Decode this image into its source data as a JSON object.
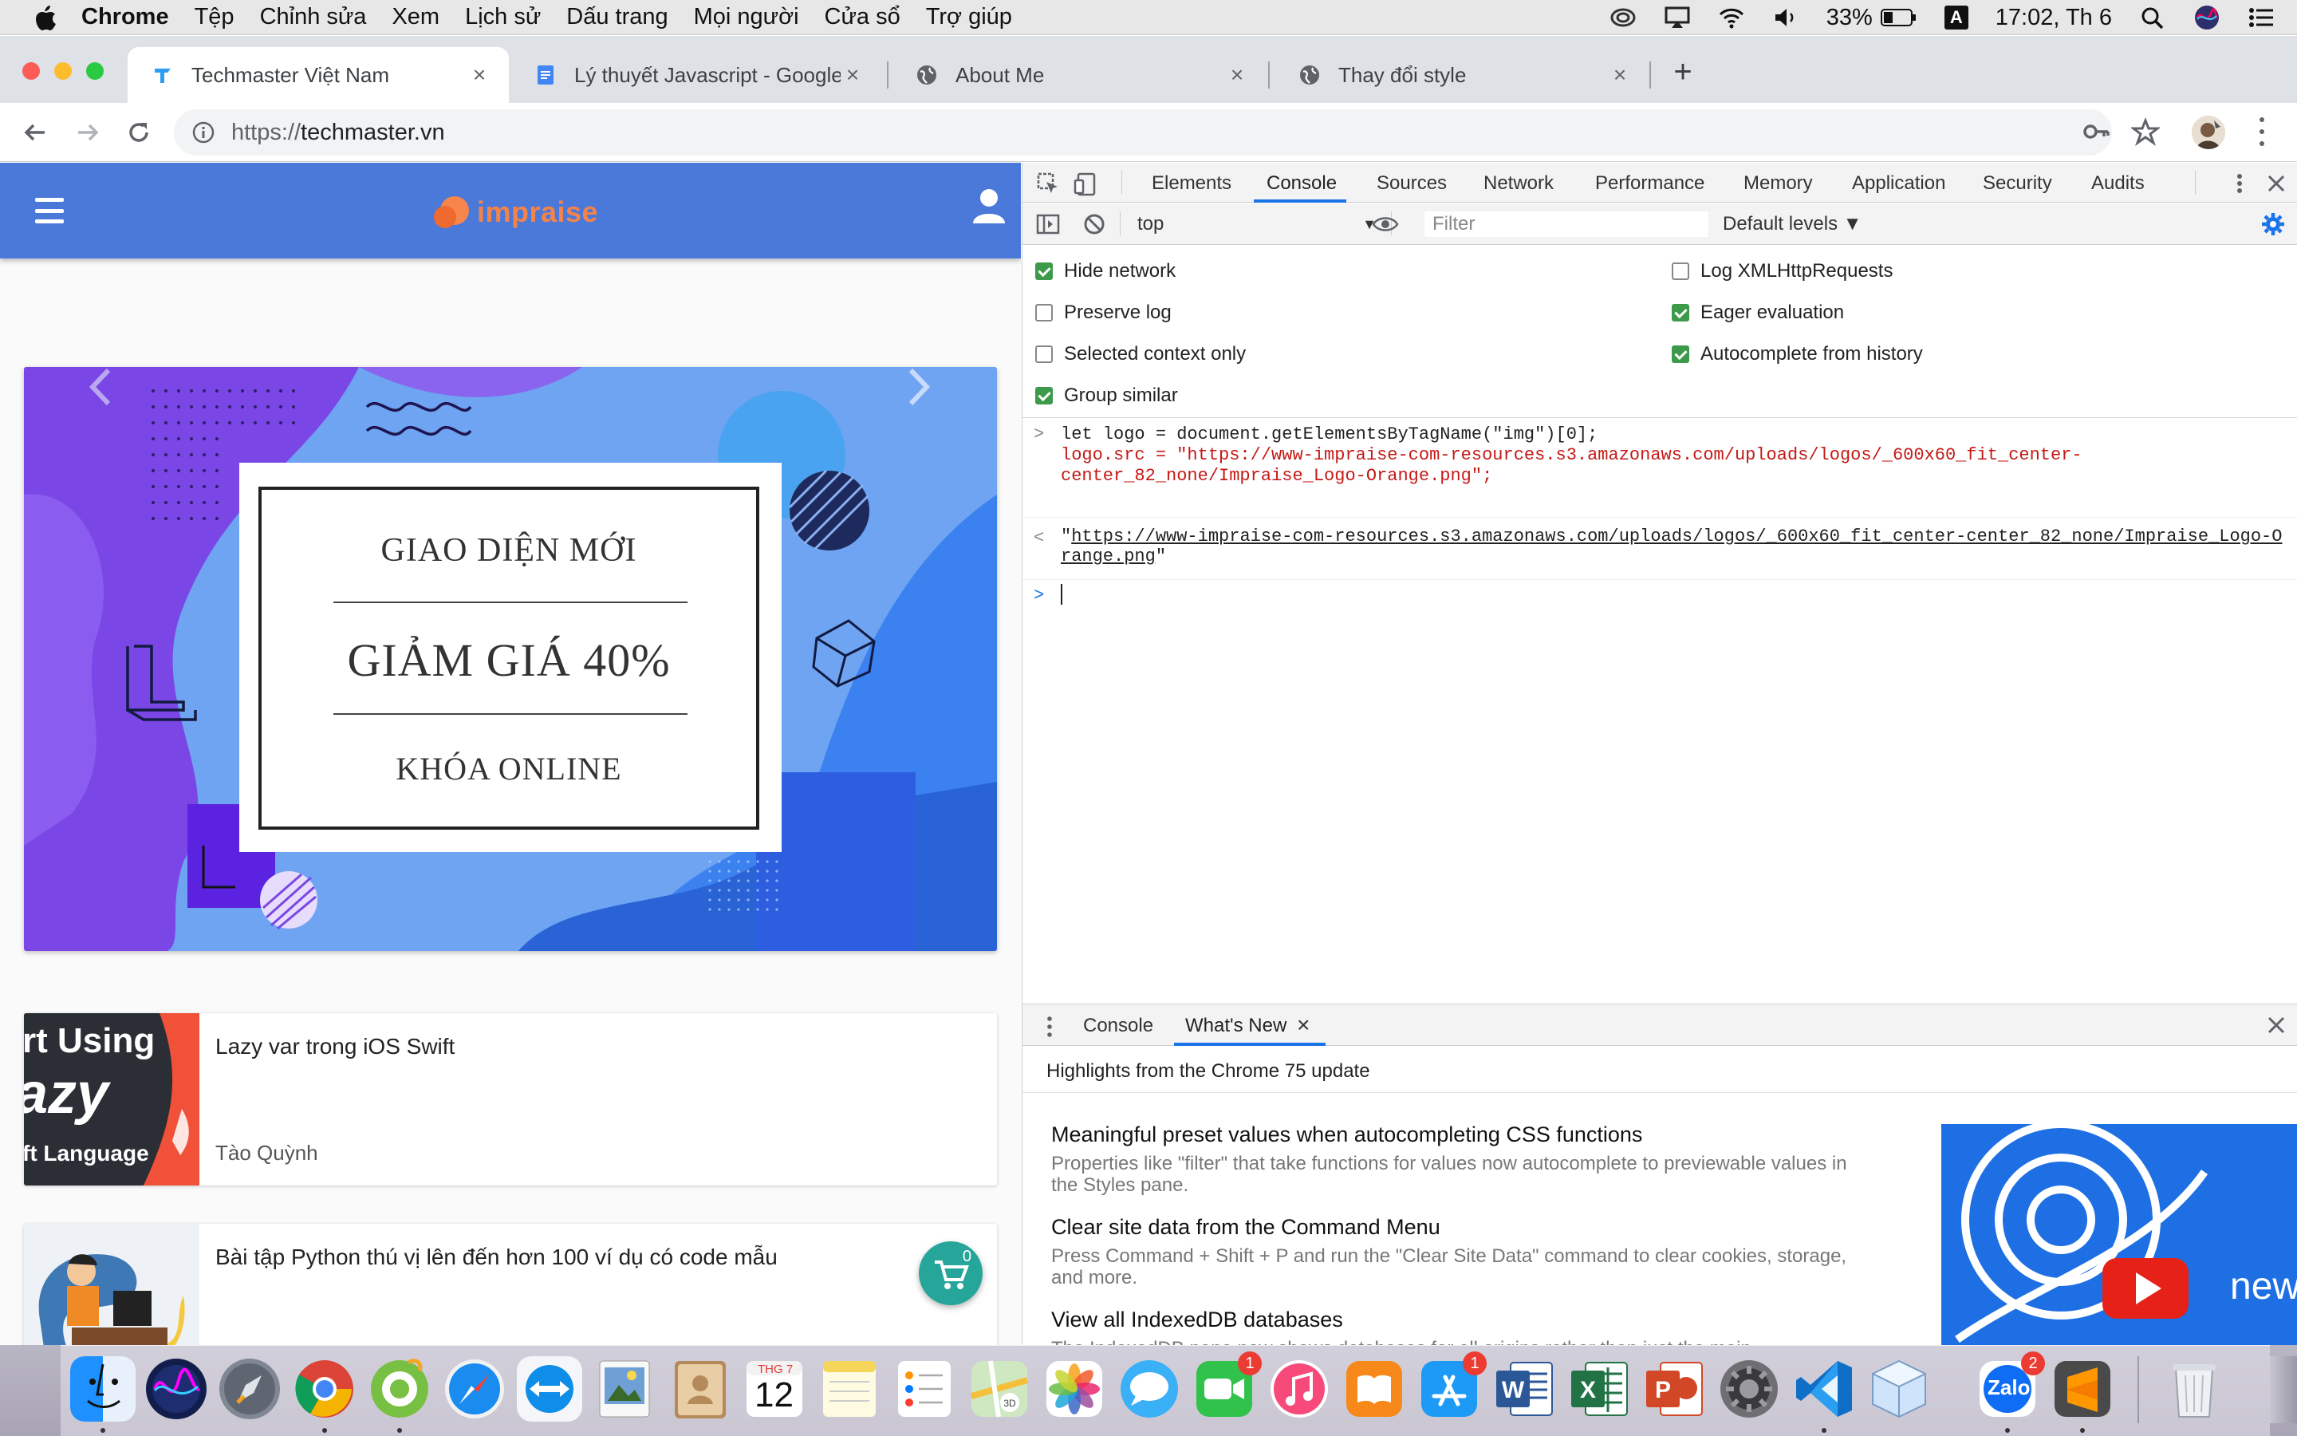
{
  "menubar": {
    "app": "Chrome",
    "items": [
      "Tệp",
      "Chỉnh sửa",
      "Xem",
      "Lịch sử",
      "Dấu trang",
      "Mọi người",
      "Cửa sổ",
      "Trợ giúp"
    ],
    "battery": "33%",
    "input_source": "A",
    "clock": "17:02, Th 6"
  },
  "tabs": [
    {
      "title": "Techmaster Việt Nam",
      "close": "×"
    },
    {
      "title": "Lý thuyết Javascript - Google T",
      "close": "×"
    },
    {
      "title": "About Me",
      "close": "×"
    },
    {
      "title": "Thay đổi style",
      "close": "×"
    }
  ],
  "newtab_label": "+",
  "omnibox": {
    "scheme": "https://",
    "host": "techmaster.vn"
  },
  "site": {
    "brand": "impraise",
    "banner": {
      "line1": "GIAO DIỆN MỚI",
      "line2": "GIẢM GIÁ 40%",
      "line3": "KHÓA ONLINE"
    },
    "posts": [
      {
        "title": "Lazy var trong iOS Swift",
        "author": "Tào Quỳnh",
        "thumb_lines": [
          "rt Using",
          "azy",
          "ft Language"
        ]
      },
      {
        "title": "Bài tập Python thú vị lên đến hơn 100 ví dụ có code mẫu",
        "author": ""
      }
    ],
    "cart_count": "0"
  },
  "devtools": {
    "tabs": [
      "Elements",
      "Console",
      "Sources",
      "Network",
      "Performance",
      "Memory",
      "Application",
      "Security",
      "Audits"
    ],
    "active_tab": "Console",
    "context": "top",
    "filter_placeholder": "Filter",
    "levels": "Default levels ▼",
    "settings": [
      {
        "label": "Hide network",
        "checked": true
      },
      {
        "label": "Preserve log",
        "checked": false
      },
      {
        "label": "Selected context only",
        "checked": false
      },
      {
        "label": "Group similar",
        "checked": true
      },
      {
        "label": "Log XMLHttpRequests",
        "checked": false
      },
      {
        "label": "Eager evaluation",
        "checked": true
      },
      {
        "label": "Autocomplete from history",
        "checked": true
      }
    ],
    "console": {
      "input_line1": "let logo = document.getElementsByTagName(\"img\")[0];",
      "input_line2": "logo.src = \"https://www-impraise-com-resources.s3.amazonaws.com/uploads/logos/_600x60_fit_center-",
      "input_line3": "center_82_none/Impraise_Logo-Orange.png\";",
      "result_url": "https://www-impraise-com-resources.s3.amazonaws.com/uploads/logos/_600x60_fit_center-center_82_none/Impraise_Logo-Orange.png"
    },
    "drawer": {
      "tabs": [
        "Console",
        "What's New"
      ],
      "active_tab": "What's New",
      "highlights": "Highlights from the Chrome 75 update",
      "items": [
        {
          "title": "Meaningful preset values when autocompleting CSS functions",
          "desc": "Properties like \"filter\" that take functions for values now autocomplete to previewable values in the Styles pane."
        },
        {
          "title": "Clear site data from the Command Menu",
          "desc": "Press Command + Shift + P and run the \"Clear Site Data\" command to clear cookies, storage, and more."
        },
        {
          "title": "View all IndexedDB databases",
          "desc": "The IndexedDB pane now shows databases for all origins rather than just the main"
        }
      ],
      "video_caption": "new"
    }
  },
  "dock": {
    "calendar_month": "THG 7",
    "calendar_day": "12",
    "badges": {
      "facetime": "1",
      "appstore": "1",
      "zalo": "2"
    },
    "zalo_label": "Zalo"
  }
}
